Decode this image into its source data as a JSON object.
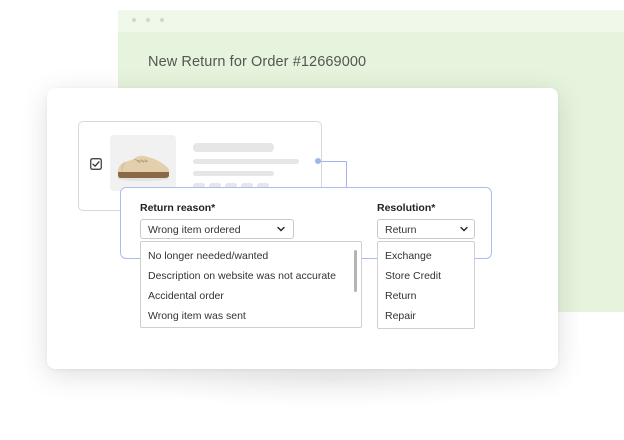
{
  "back_window": {
    "title": "New Return for Order #12669000"
  },
  "return_reason": {
    "label": "Return reason*",
    "selected": "Wrong item ordered",
    "options": [
      "No longer needed/wanted",
      "Description on website was not accurate",
      "Accidental order",
      "Wrong item was sent"
    ]
  },
  "resolution": {
    "label": "Resolution*",
    "selected": "Return",
    "options": [
      "Exchange",
      "Store Credit",
      "Return",
      "Repair"
    ]
  },
  "product": {
    "checked": true
  },
  "colors": {
    "accent_blue": "#a9bdf3",
    "back_window_green": "#e6f4dd"
  }
}
